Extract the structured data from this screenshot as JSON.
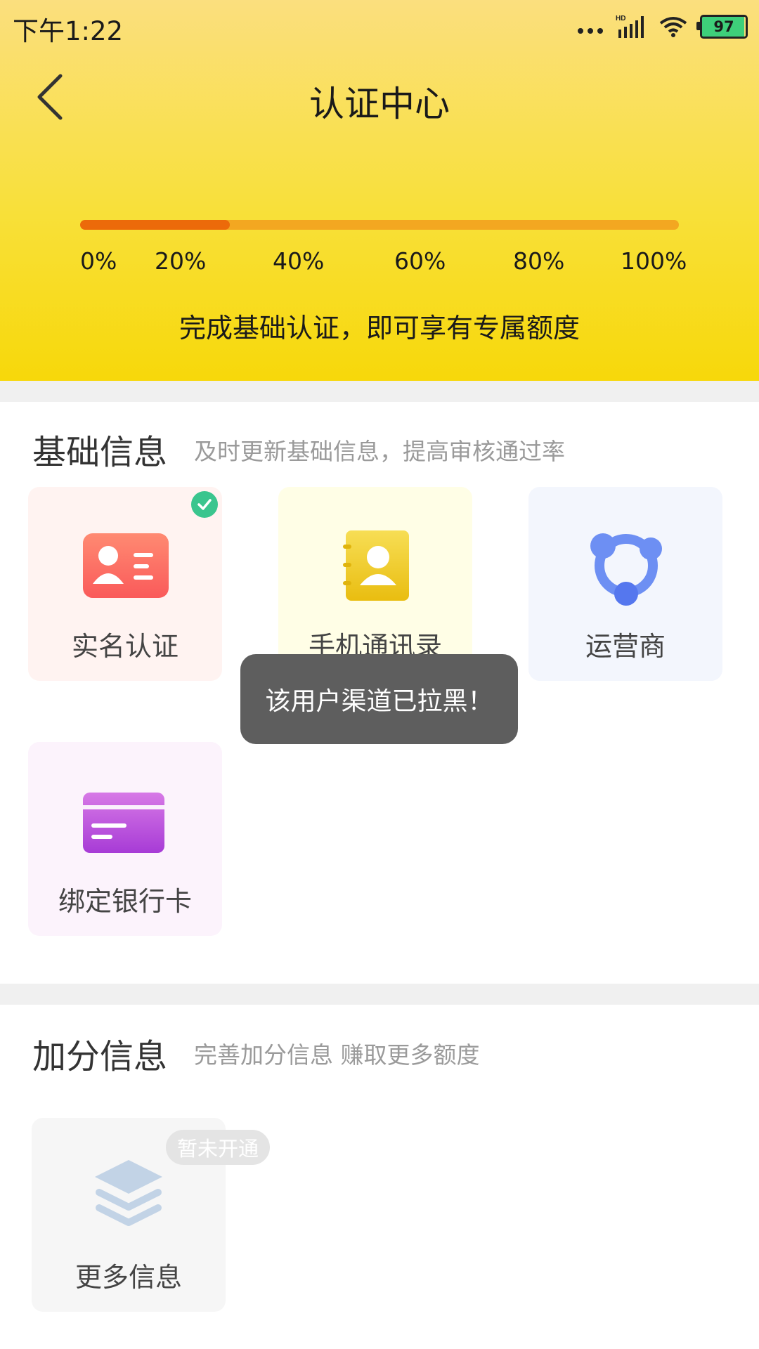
{
  "status_bar": {
    "time": "下午1:22",
    "network_label": "HD",
    "battery_level": "97"
  },
  "header": {
    "title": "认证中心",
    "progress_fraction": 0.25,
    "ticks": [
      "0%",
      "20%",
      "40%",
      "60%",
      "80%",
      "100%"
    ],
    "hint": "完成基础认证，即可享有专属额度",
    "colors": {
      "fill": "#ec6a0a",
      "track": "#f3a721"
    }
  },
  "basic_section": {
    "title": "基础信息",
    "subtitle": "及时更新基础信息，提高审核通过率",
    "cards": [
      {
        "label": "实名认证",
        "icon": "id-card-icon",
        "verified": true
      },
      {
        "label": "手机通讯录",
        "icon": "contacts-book-icon",
        "verified": false
      },
      {
        "label": "运营商",
        "icon": "carrier-network-icon",
        "verified": false
      },
      {
        "label": "绑定银行卡",
        "icon": "bank-card-icon",
        "verified": false
      }
    ]
  },
  "bonus_section": {
    "title": "加分信息",
    "subtitle": "完善加分信息 赚取更多额度",
    "cards": [
      {
        "label": "更多信息",
        "icon": "layers-icon",
        "badge": "暂未开通"
      }
    ]
  },
  "toast": {
    "message": "该用户渠道已拉黑！"
  }
}
